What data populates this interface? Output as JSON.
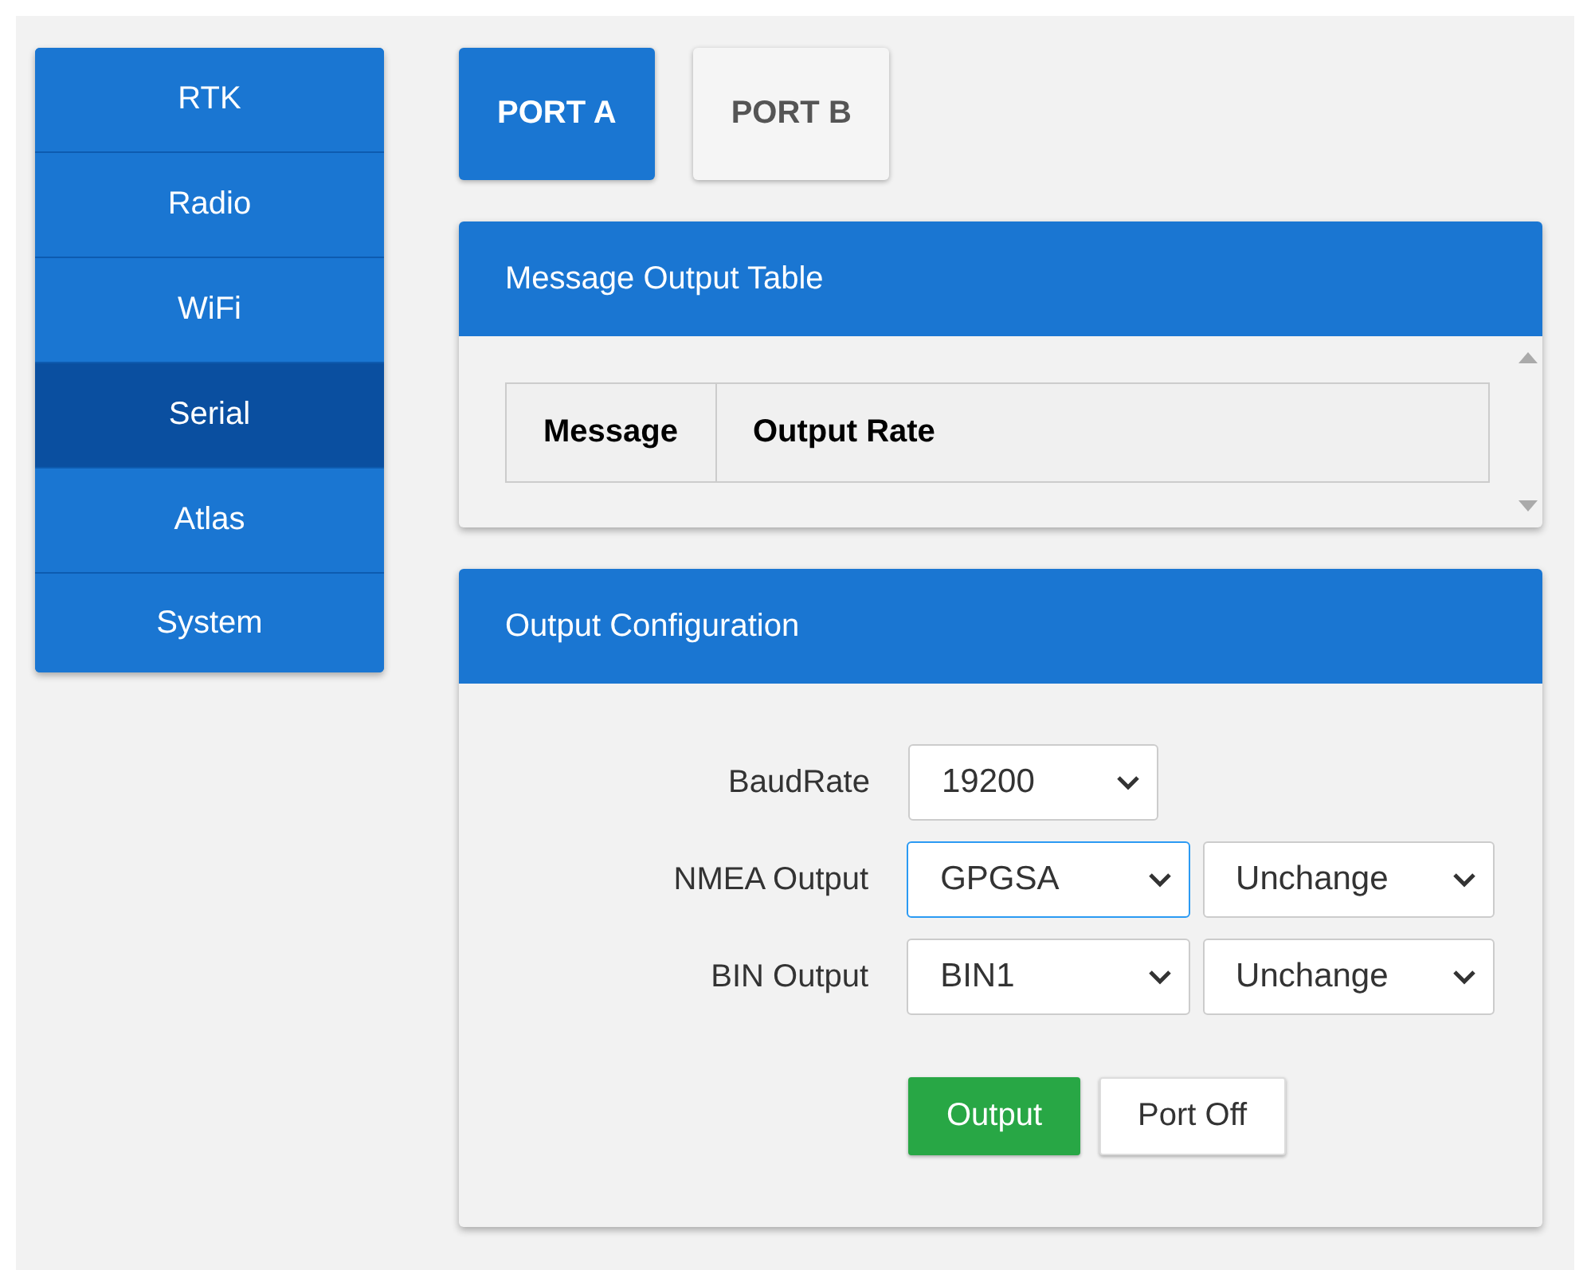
{
  "sidebar": {
    "items": [
      {
        "label": "RTK",
        "selected": false
      },
      {
        "label": "Radio",
        "selected": false
      },
      {
        "label": "WiFi",
        "selected": false
      },
      {
        "label": "Serial",
        "selected": true
      },
      {
        "label": "Atlas",
        "selected": false
      },
      {
        "label": "System",
        "selected": false
      }
    ]
  },
  "port_tabs": [
    {
      "label": "PORT A",
      "selected": true
    },
    {
      "label": "PORT B",
      "selected": false
    }
  ],
  "message_table": {
    "title": "Message Output Table",
    "columns": [
      "Message",
      "Output Rate"
    ]
  },
  "output_config": {
    "title": "Output Configuration",
    "rows": [
      {
        "label": "BaudRate",
        "selects": [
          {
            "value": "19200",
            "focused": false
          }
        ]
      },
      {
        "label": "NMEA Output",
        "selects": [
          {
            "value": "GPGSA",
            "focused": true
          },
          {
            "value": "Unchange",
            "focused": false
          }
        ]
      },
      {
        "label": "BIN Output",
        "selects": [
          {
            "value": "BIN1",
            "focused": false
          },
          {
            "value": "Unchange",
            "focused": false
          }
        ]
      }
    ],
    "buttons": [
      {
        "label": "Output",
        "kind": "primary"
      },
      {
        "label": "Port Off",
        "kind": "default"
      }
    ]
  }
}
